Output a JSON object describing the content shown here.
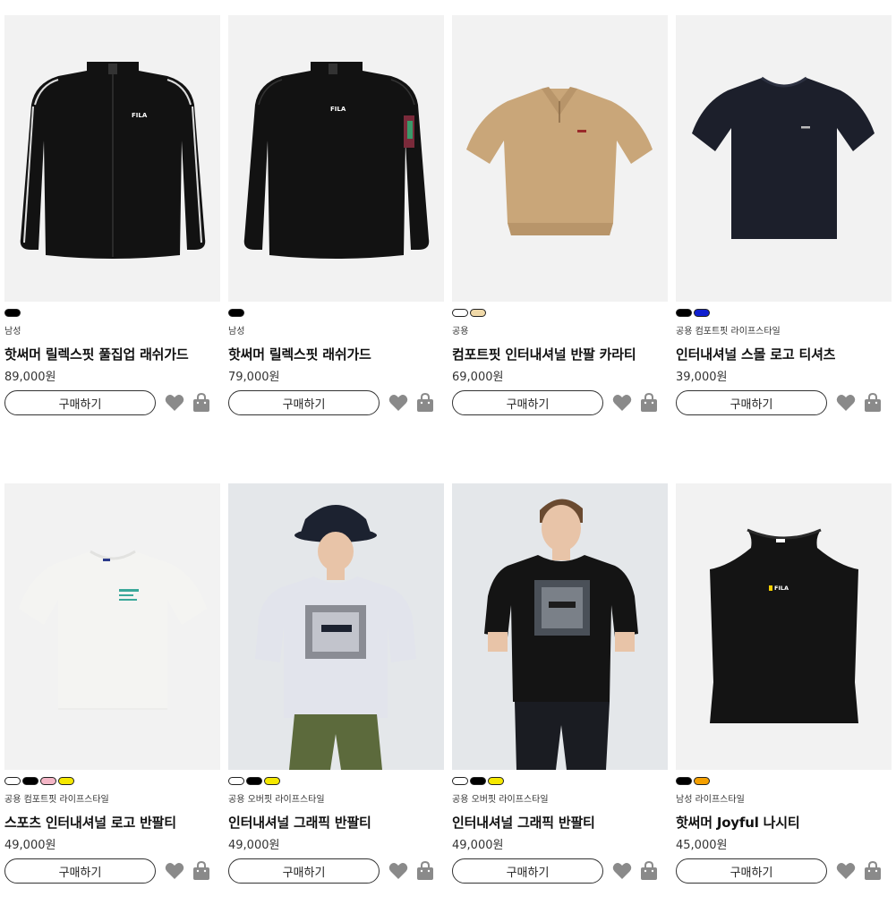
{
  "buy_label": "구매하기",
  "products": [
    {
      "tags": "남성",
      "name": "핫써머 릴렉스핏 풀집업 래쉬가드",
      "price": "89,000원",
      "swatches": [
        "#000000"
      ],
      "image": "fullzip-rashguard",
      "logo": "FILA"
    },
    {
      "tags": "남성",
      "name": "핫써머 릴렉스핏 래쉬가드",
      "price": "79,000원",
      "swatches": [
        "#000000"
      ],
      "image": "rashguard",
      "logo": "FILA"
    },
    {
      "tags": "공용",
      "name": "컴포트핏 인터내셔널 반팔 카라티",
      "price": "69,000원",
      "swatches": [
        "#ffffff",
        "#f0d9a8"
      ],
      "image": "collar-shirt"
    },
    {
      "tags": "공용 컴포트핏 라이프스타일",
      "name": "인터내셔널 스몰 로고 티셔츠",
      "price": "39,000원",
      "swatches": [
        "#000000",
        "#1020d0"
      ],
      "image": "navy-tee"
    },
    {
      "tags": "공용 컴포트핏 라이프스타일",
      "name": "스포츠 인터내셔널 로고 반팔티",
      "price": "49,000원",
      "swatches": [
        "#ffffff",
        "#000000",
        "#f4b6c6",
        "#f5e800"
      ],
      "image": "white-tee"
    },
    {
      "tags": "공용 오버핏 라이프스타일",
      "name": "인터내셔널 그래픽 반팔티",
      "price": "49,000원",
      "swatches": [
        "#ffffff",
        "#000000",
        "#f5e800"
      ],
      "image": "model-female"
    },
    {
      "tags": "공용 오버핏 라이프스타일",
      "name": "인터내셔널 그래픽 반팔티",
      "price": "49,000원",
      "swatches": [
        "#ffffff",
        "#000000",
        "#f5e800"
      ],
      "image": "model-male"
    },
    {
      "tags": "남성 라이프스타일",
      "name": "핫써머 Joyful 나시티",
      "price": "45,000원",
      "swatches": [
        "#000000",
        "#f5a000"
      ],
      "image": "sleeveless",
      "logo": "FILA"
    }
  ]
}
